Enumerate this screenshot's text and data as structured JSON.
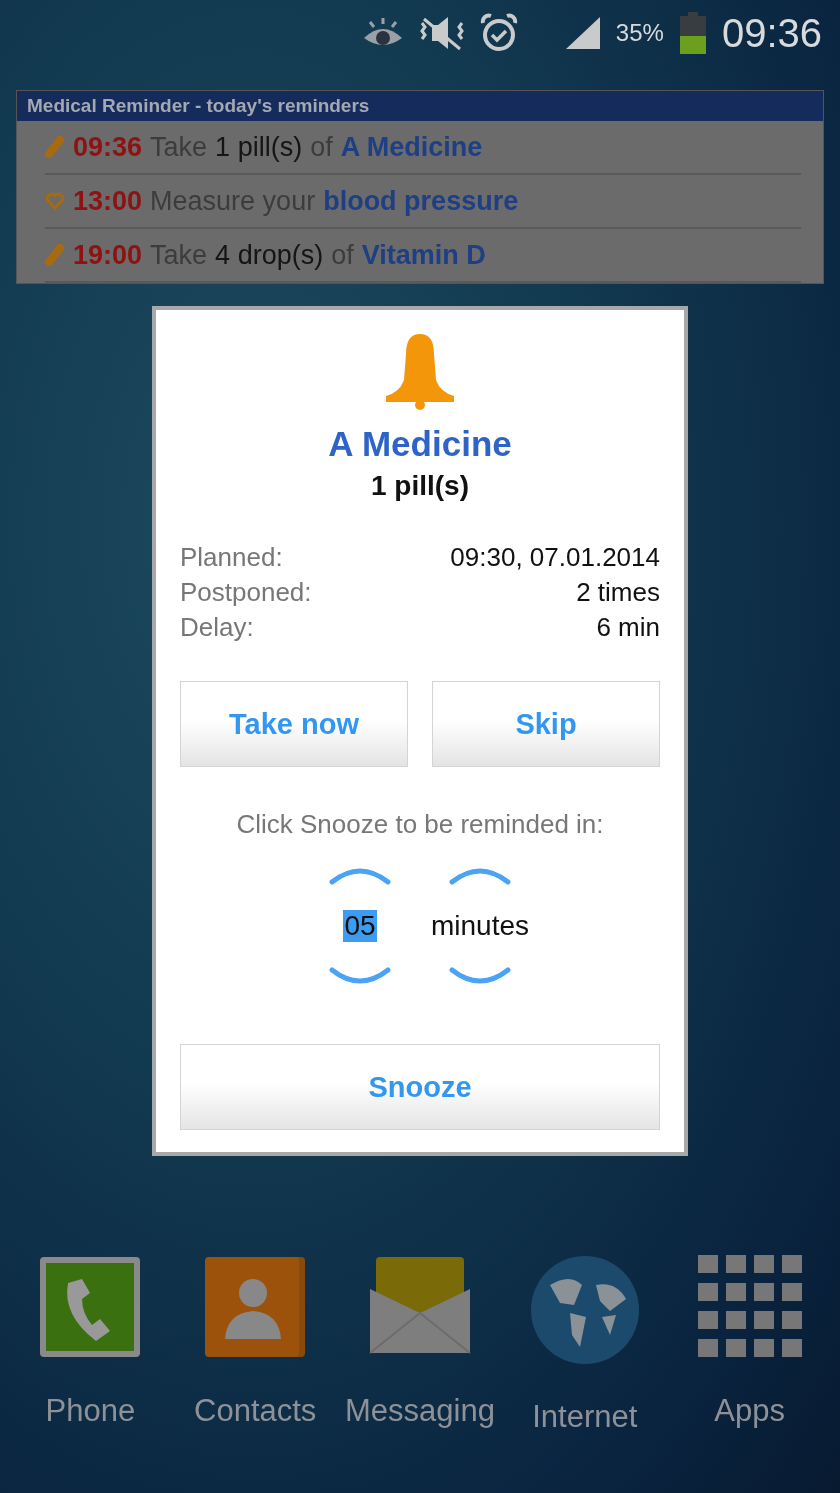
{
  "status_bar": {
    "battery": "35%",
    "time": "09:36"
  },
  "widget": {
    "title": "Medical Reminder - today's reminders",
    "rows": [
      {
        "kind": "pill",
        "time": "09:36",
        "parts": [
          {
            "kind": "muted",
            "text": "Take"
          },
          {
            "kind": "plain",
            "text": "1 pill(s)"
          },
          {
            "kind": "muted",
            "text": "of"
          },
          {
            "kind": "name",
            "text": "A Medicine"
          }
        ]
      },
      {
        "kind": "heart",
        "time": "13:00",
        "parts": [
          {
            "kind": "muted",
            "text": "Measure your"
          },
          {
            "kind": "name",
            "text": "blood pressure"
          }
        ]
      },
      {
        "kind": "pill",
        "time": "19:00",
        "parts": [
          {
            "kind": "muted",
            "text": "Take"
          },
          {
            "kind": "plain",
            "text": "4 drop(s)"
          },
          {
            "kind": "muted",
            "text": "of"
          },
          {
            "kind": "name",
            "text": "Vitamin D"
          }
        ]
      }
    ]
  },
  "dialog": {
    "title": "A Medicine",
    "dose": "1 pill(s)",
    "details": [
      {
        "label": "Planned:",
        "value": "09:30, 07.01.2014"
      },
      {
        "label": "Postponed:",
        "value": "2 times"
      },
      {
        "label": "Delay:",
        "value": "6 min"
      }
    ],
    "buttons": [
      "Take now",
      "Skip"
    ],
    "snooze_hint": "Click Snooze to be reminded in:",
    "minutes_field": {
      "value": "05",
      "selected": true
    },
    "unit": "minutes",
    "snooze_button": "Snooze"
  },
  "dock": [
    {
      "kind": "phone",
      "label": "Phone"
    },
    {
      "kind": "contacts",
      "label": "Contacts"
    },
    {
      "kind": "messaging",
      "label": "Messaging"
    },
    {
      "kind": "internet",
      "label": "Internet"
    },
    {
      "kind": "apps",
      "label": "Apps"
    }
  ]
}
